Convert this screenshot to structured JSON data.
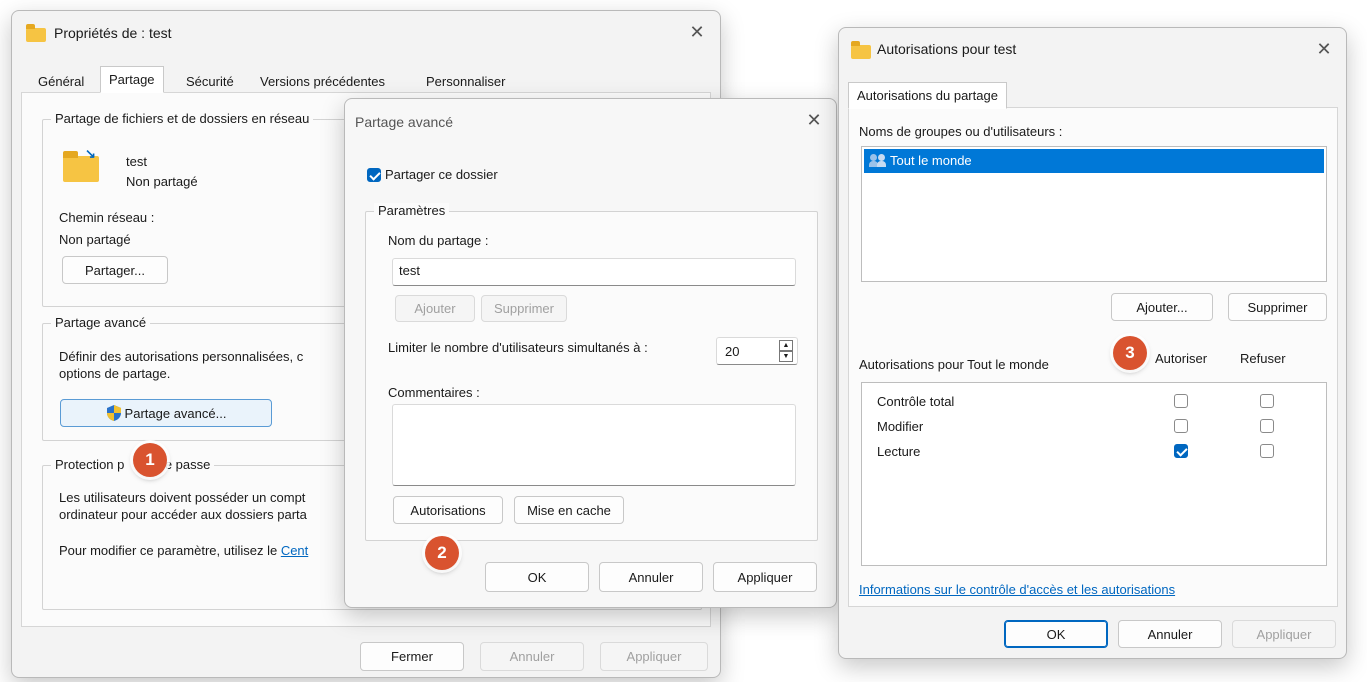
{
  "props_window": {
    "title": "Propriétés de : test",
    "tabs": [
      "Général",
      "Partage",
      "Sécurité",
      "Versions précédentes",
      "Personnaliser"
    ],
    "network_share": {
      "group_label": "Partage de fichiers et de dossiers en réseau",
      "folder_name": "test",
      "folder_status": "Non partagé",
      "path_label": "Chemin réseau :",
      "path_value": "Non partagé",
      "share_button": "Partager..."
    },
    "advanced": {
      "group_label": "Partage avancé",
      "description_line1": "Définir des autorisations personnalisées, c",
      "description_line2": "options de partage.",
      "button": "Partage avancé..."
    },
    "password": {
      "group_label_left": "Protection p",
      "group_label_right": "t de passe",
      "line1": "Les utilisateurs doivent posséder un compt",
      "line2": "ordinateur pour accéder aux dossiers parta",
      "line3_prefix": "Pour modifier ce paramètre, utilisez le ",
      "line3_link": "Cent"
    },
    "footer": {
      "close": "Fermer",
      "cancel": "Annuler",
      "apply": "Appliquer"
    }
  },
  "advanced_window": {
    "title": "Partage avancé",
    "share_checkbox_label": "Partager ce dossier",
    "share_checked": true,
    "params_label": "Paramètres",
    "share_name_label": "Nom du partage :",
    "share_name_value": "test",
    "add_button": "Ajouter",
    "remove_button": "Supprimer",
    "limit_label": "Limiter le nombre d'utilisateurs simultanés à :",
    "limit_value": "20",
    "comments_label": "Commentaires :",
    "comments_value": "",
    "permissions_button": "Autorisations",
    "caching_button": "Mise en cache",
    "footer": {
      "ok": "OK",
      "cancel": "Annuler",
      "apply": "Appliquer"
    }
  },
  "permissions_window": {
    "title": "Autorisations pour test",
    "tab": "Autorisations du partage",
    "groups_label": "Noms de groupes ou d'utilisateurs :",
    "groups": [
      "Tout le monde"
    ],
    "add_button": "Ajouter...",
    "remove_button": "Supprimer",
    "permissions_for_label": "Autorisations pour Tout le monde",
    "allow_header": "Autoriser",
    "deny_header": "Refuser",
    "rows": [
      {
        "name": "Contrôle total",
        "allow": false,
        "deny": false
      },
      {
        "name": "Modifier",
        "allow": false,
        "deny": false
      },
      {
        "name": "Lecture",
        "allow": true,
        "deny": false
      }
    ],
    "info_link": "Informations sur le contrôle d'accès et les autorisations",
    "footer": {
      "ok": "OK",
      "cancel": "Annuler",
      "apply": "Appliquer"
    }
  },
  "badges": [
    "1",
    "2",
    "3"
  ],
  "icons": {
    "folder": "folder-icon",
    "shared_folder": "shared-folder-icon",
    "uac_shield": "uac-shield-icon",
    "users": "users-group-icon",
    "close": "close-icon"
  },
  "colors": {
    "accent": "#0067c0",
    "badge": "#d9532f",
    "selection": "#0078d7"
  }
}
